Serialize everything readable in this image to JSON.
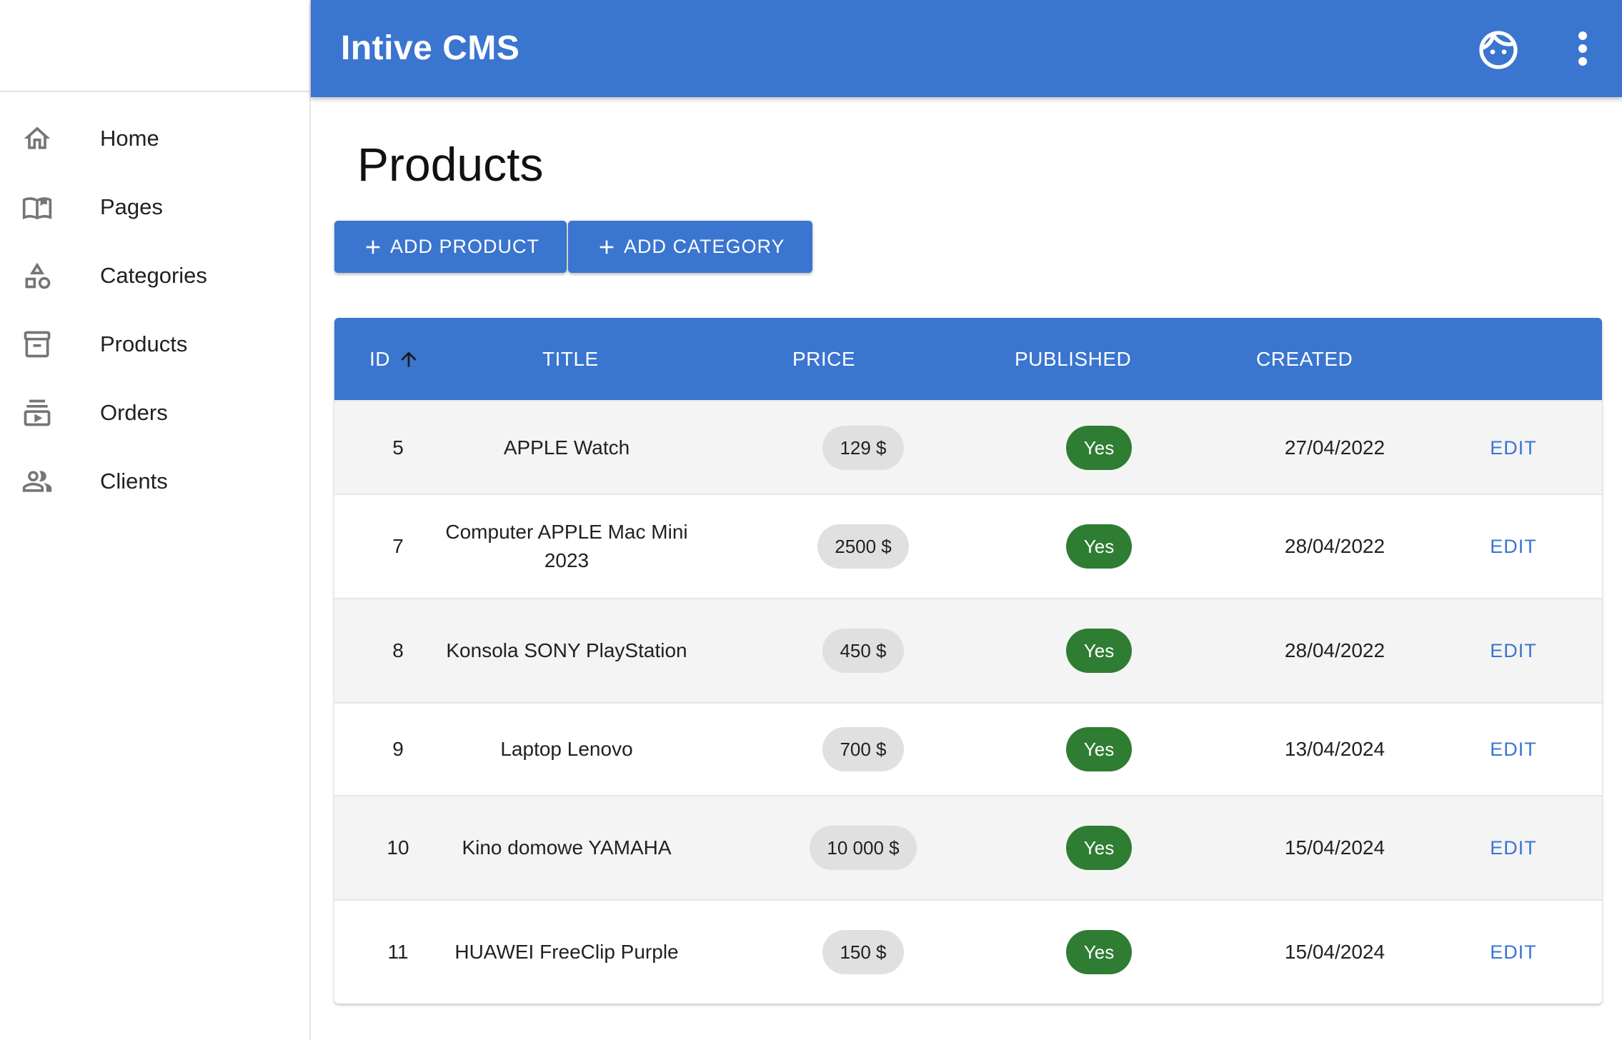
{
  "app": {
    "title": "Intive CMS"
  },
  "sidebar": {
    "items": [
      {
        "label": "Home",
        "icon": "home-icon"
      },
      {
        "label": "Pages",
        "icon": "book-icon"
      },
      {
        "label": "Categories",
        "icon": "category-shapes-icon"
      },
      {
        "label": "Products",
        "icon": "archive-box-icon"
      },
      {
        "label": "Orders",
        "icon": "subscriptions-icon"
      },
      {
        "label": "Clients",
        "icon": "people-icon"
      }
    ]
  },
  "header": {
    "avatar_icon": "face-icon",
    "menu_icon": "more-vert-icon"
  },
  "main": {
    "title": "Products",
    "add_product_label": "ADD PRODUCT",
    "add_category_label": "ADD CATEGORY"
  },
  "table": {
    "columns": {
      "id": "ID",
      "title": "TITLE",
      "price": "PRICE",
      "published": "PUBLISHED",
      "created": "CREATED"
    },
    "sort": {
      "column": "ID",
      "direction": "ascending",
      "icon": "arrow-up-icon"
    },
    "edit_label": "EDIT",
    "rows": [
      {
        "id": "5",
        "title": "APPLE Watch",
        "price": "129 $",
        "published": "Yes",
        "created": "27/04/2022"
      },
      {
        "id": "7",
        "title": "Computer APPLE Mac Mini 2023",
        "price": "2500 $",
        "published": "Yes",
        "created": "28/04/2022"
      },
      {
        "id": "8",
        "title": "Konsola SONY PlayStation",
        "price": "450 $",
        "published": "Yes",
        "created": "28/04/2022"
      },
      {
        "id": "9",
        "title": "Laptop Lenovo",
        "price": "700 $",
        "published": "Yes",
        "created": "13/04/2024"
      },
      {
        "id": "10",
        "title": "Kino domowe YAMAHA",
        "price": "10 000 $",
        "published": "Yes",
        "created": "15/04/2024"
      },
      {
        "id": "11",
        "title": "HUAWEI FreeClip Purple",
        "price": "150 $",
        "published": "Yes",
        "created": "15/04/2024"
      }
    ]
  },
  "colors": {
    "primary": "#3a75cf",
    "published": "#2e7d32",
    "chip": "#e0e0e0"
  }
}
